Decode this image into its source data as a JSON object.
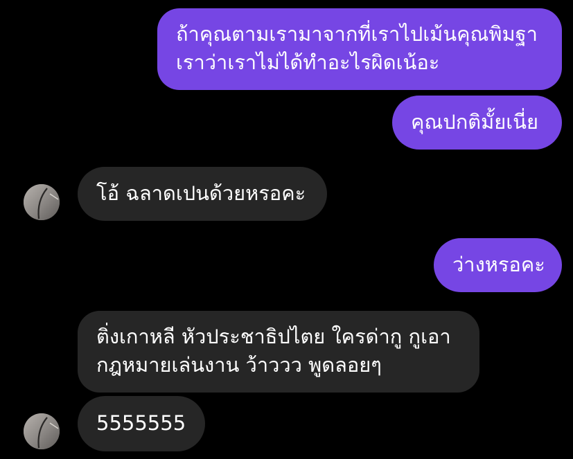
{
  "colors": {
    "background": "#000000",
    "outgoing_bubble": "#7646e4",
    "incoming_bubble": "#262626",
    "text": "#ffffff"
  },
  "messages": [
    {
      "direction": "outgoing",
      "lines": [
        "ถ้าคุณตามเรามาจากที่เราไปเม้นคุณพิมฐา",
        "เราว่าเราไม่ได้ทำอะไรผิดเน้อะ"
      ]
    },
    {
      "direction": "outgoing",
      "lines": [
        "คุณปกติมั้ยเนี่ย"
      ]
    },
    {
      "direction": "incoming",
      "avatar_icon": "profile-photo-avatar",
      "lines": [
        "โอ้ ฉลาดเปนด้วยหรอคะ"
      ]
    },
    {
      "direction": "outgoing",
      "lines": [
        "ว่างหรอคะ"
      ]
    },
    {
      "direction": "incoming",
      "lines": [
        "ติ่งเกาหลี หัวประชาธิปไตย ใครด่ากู กูเอา",
        "กฎหมายเล่นงาน ว้าววว พูดลอยๆ"
      ]
    },
    {
      "direction": "incoming",
      "avatar_icon": "profile-photo-avatar",
      "lines": [
        "5555555"
      ]
    }
  ]
}
